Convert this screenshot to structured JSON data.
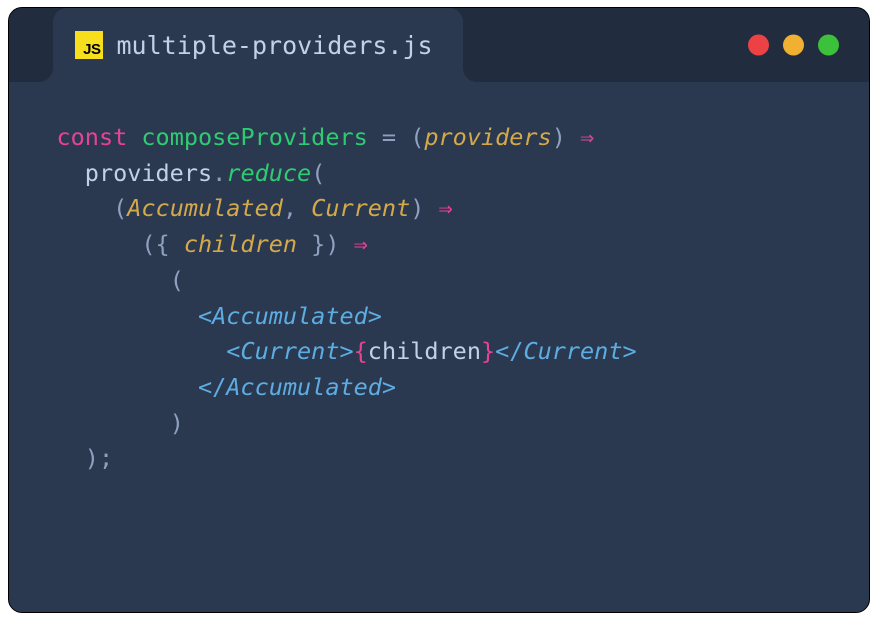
{
  "tab": {
    "icon_label": "JS",
    "filename": "multiple-providers.js"
  },
  "code": {
    "const": "const",
    "fname": "composeProviders",
    "eq": " = ",
    "lp1": "(",
    "p_providers": "providers",
    "rp1": ")",
    "arrow1": " ⇒",
    "ind1": "  ",
    "obj_providers": "providers",
    "dot": ".",
    "reduce": "reduce",
    "lp2": "(",
    "ind2": "    ",
    "lp3": "(",
    "p_acc": "Accumulated",
    "comma1": ", ",
    "p_cur": "Current",
    "rp3": ")",
    "arrow2": " ⇒",
    "ind3": "      ",
    "lp4": "(",
    "lb1": "{ ",
    "p_children": "children",
    "rb1": " }",
    "rp4": ")",
    "arrow3": " ⇒",
    "ind4": "        ",
    "lp5": "(",
    "ind5": "          ",
    "lt1": "<",
    "tag_acc": "Accumulated",
    "gt1": ">",
    "ind6": "            ",
    "lt2": "<",
    "tag_cur": "Current",
    "gt2": ">",
    "lb2": "{",
    "var_children": "children",
    "rb2": "}",
    "lt3": "</",
    "tag_cur2": "Current",
    "gt3": ">",
    "lt4": "</",
    "tag_acc2": "Accumulated",
    "gt4": ">",
    "rp5": ")",
    "rp6": ")",
    "semi": ";"
  }
}
